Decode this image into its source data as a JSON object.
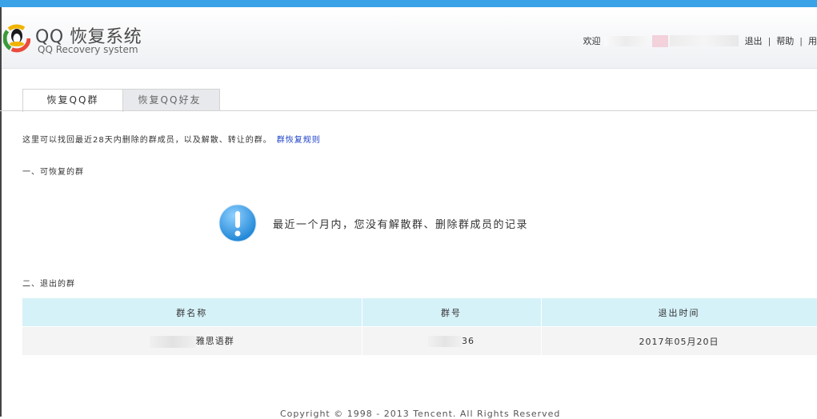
{
  "header": {
    "title": "QQ 恢复系统",
    "subtitle": "QQ Recovery system",
    "welcome": "欢迎",
    "logout": "退出",
    "help": "帮助",
    "extra": "用"
  },
  "tabs": [
    {
      "label": "恢复QQ群",
      "active": true
    },
    {
      "label": "恢复QQ好友",
      "active": false
    }
  ],
  "intro": {
    "text": "这里可以找回最近28天内删除的群成员，以及解散、转让的群。",
    "link": "群恢复规则"
  },
  "section1": {
    "title": "一、可恢复的群",
    "notice": "最近一个月内，您没有解散群、删除群成员的记录"
  },
  "section2": {
    "title": "二、退出的群",
    "columns": [
      "群名称",
      "群号",
      "退出时间"
    ],
    "rows": [
      {
        "name_suffix": "雅思语群",
        "id_suffix": "36",
        "time": "2017年05月20日"
      }
    ]
  },
  "footer": "Copyright © 1998 - 2013 Tencent. All Rights Reserved",
  "colors": {
    "topbar": "#3aa3e8",
    "table_header": "#d6f2f9",
    "link": "#1a3fc8"
  }
}
